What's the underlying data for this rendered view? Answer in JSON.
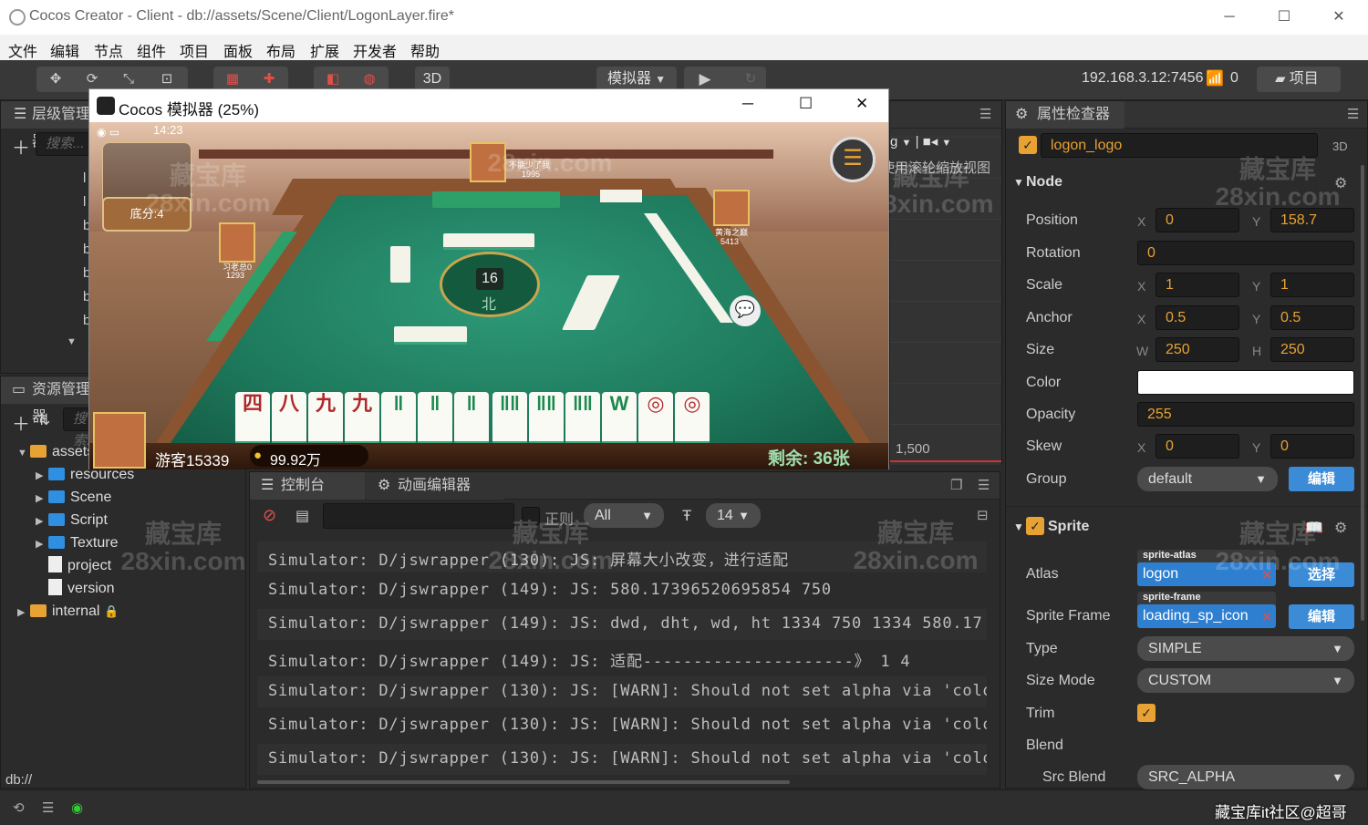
{
  "titlebar": {
    "title": "Cocos Creator - Client - db://assets/Scene/Client/LogonLayer.fire*",
    "min": "─",
    "max": "☐",
    "close": "✕"
  },
  "menu": [
    "文件",
    "编辑",
    "节点",
    "组件",
    "项目",
    "面板",
    "布局",
    "扩展",
    "开发者",
    "帮助"
  ],
  "toolbar": {
    "mode3d": "3D",
    "platform": "模拟器",
    "ip": "192.168.3.12:7456",
    "clients": "0",
    "project": "项目"
  },
  "hierarchy": {
    "tab": "层级管理器",
    "search": "搜索..."
  },
  "assets": {
    "tab": "资源管理器",
    "search": "搜索...",
    "items": [
      {
        "label": "assets"
      },
      {
        "label": "resources"
      },
      {
        "label": "Scene"
      },
      {
        "label": "Script"
      },
      {
        "label": "Texture"
      },
      {
        "label": "project"
      },
      {
        "label": "version"
      },
      {
        "label": "internal"
      }
    ]
  },
  "scene": {
    "hint": "使用滚轮缩放视图",
    "ruler": "1,500",
    "icon_g": "g"
  },
  "simulator": {
    "title": "Cocos 模拟器 (25%)",
    "time": "14:23",
    "base_score": "底分:4",
    "dice": "16",
    "wind": "北",
    "player_top_name": "不能少了我",
    "player_top_score": "1995",
    "player_left_name": "习老总0",
    "player_left_score": "1293",
    "player_right_name": "黄海之巅",
    "player_right_score": "5413",
    "player_name": "游客15339",
    "coins": "99.92万",
    "remain": "剩余: 36张",
    "tiles": [
      "四",
      "八",
      "九",
      "九",
      "‖",
      "‖",
      "‖",
      "‖‖",
      "‖‖",
      "‖‖",
      "W",
      "◎",
      "◎"
    ]
  },
  "console": {
    "tabs": [
      "控制台",
      "动画编辑器"
    ],
    "regex": "正则",
    "level": "All",
    "font_size": "14",
    "lines": [
      "Simulator: D/jswrapper (130): JS: 屏幕大小改变，进行适配",
      "Simulator: D/jswrapper (149): JS: 580.17396520695854 750",
      "Simulator: D/jswrapper (149): JS: dwd, dht, wd, ht 1334 750 1334 580.17",
      "Simulator: D/jswrapper (149): JS: 适配---------------------》 1 4",
      "Simulator: D/jswrapper (130): JS: [WARN]: Should not set alpha via 'colo",
      "Simulator: D/jswrapper (130): JS: [WARN]: Should not set alpha via 'colo",
      "Simulator: D/jswrapper (130): JS: [WARN]: Should not set alpha via 'colo"
    ]
  },
  "inspector": {
    "tab": "属性检查器",
    "node_name": "logon_logo",
    "tag3d": "3D",
    "node_section": "Node",
    "position": {
      "label": "Position",
      "x": "0",
      "y": "158.7"
    },
    "rotation": {
      "label": "Rotation",
      "value": "0"
    },
    "scale": {
      "label": "Scale",
      "x": "1",
      "y": "1"
    },
    "anchor": {
      "label": "Anchor",
      "x": "0.5",
      "y": "0.5"
    },
    "size": {
      "label": "Size",
      "w": "250",
      "h": "250"
    },
    "color": {
      "label": "Color",
      "value": "#ffffff"
    },
    "opacity": {
      "label": "Opacity",
      "value": "255"
    },
    "skew": {
      "label": "Skew",
      "x": "0",
      "y": "0"
    },
    "group": {
      "label": "Group",
      "value": "default",
      "edit": "编辑"
    },
    "sprite_section": "Sprite",
    "atlas": {
      "label": "Atlas",
      "tag": "sprite-atlas",
      "value": "logon",
      "btn": "选择"
    },
    "sprite_frame": {
      "label": "Sprite Frame",
      "tag": "sprite-frame",
      "value": "loading_sp_icon",
      "btn": "编辑"
    },
    "type": {
      "label": "Type",
      "value": "SIMPLE"
    },
    "size_mode": {
      "label": "Size Mode",
      "value": "CUSTOM"
    },
    "trim": {
      "label": "Trim"
    },
    "blend": {
      "label": "Blend"
    },
    "src_blend": {
      "label": "Src Blend",
      "value": "SRC_ALPHA"
    }
  },
  "axes": {
    "x": "X",
    "y": "Y",
    "w": "W",
    "h": "H"
  },
  "status": {
    "path": "db://"
  },
  "watermarks": [
    "藏宝库\n28xin.com"
  ],
  "footer_watermark": "藏宝库it社区@超哥",
  "colors": {
    "accent": "#e8a233",
    "blue": "#3b8bd6",
    "folder": "#2f8fe0",
    "table": "#1e7a5c"
  }
}
